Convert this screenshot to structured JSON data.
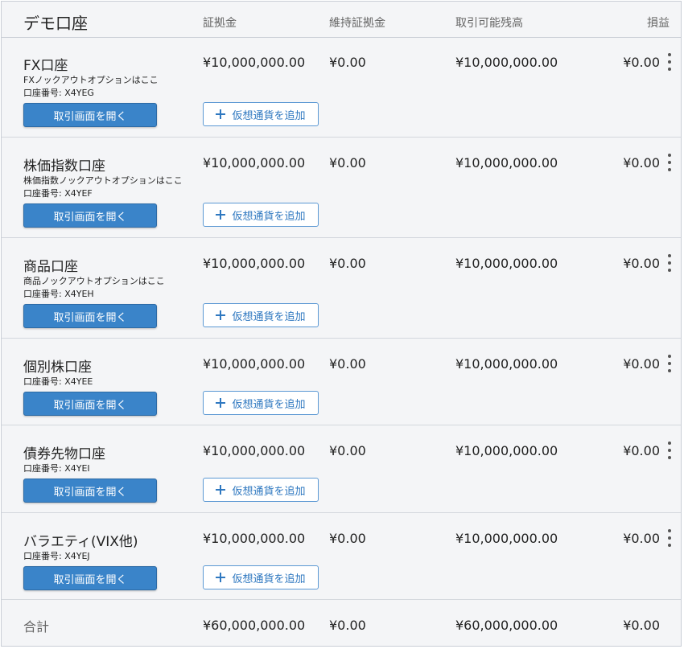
{
  "header": {
    "title": "デモ口座",
    "columns": {
      "margin": "証拠金",
      "maintenance": "維持証拠金",
      "available": "取引可能残高",
      "pl": "損益"
    }
  },
  "accounts": [
    {
      "name": "FX口座",
      "description": "FXノックアウトオプションはここ",
      "number": "口座番号: X4YEG",
      "margin": "¥10,000,000.00",
      "maintenance": "¥0.00",
      "available": "¥10,000,000.00",
      "pl": "¥0.00",
      "open_label": "取引画面を開く",
      "add_label": "仮想通貨を追加"
    },
    {
      "name": "株価指数口座",
      "description": "株価指数ノックアウトオプションはここ",
      "number": "口座番号: X4YEF",
      "margin": "¥10,000,000.00",
      "maintenance": "¥0.00",
      "available": "¥10,000,000.00",
      "pl": "¥0.00",
      "open_label": "取引画面を開く",
      "add_label": "仮想通貨を追加"
    },
    {
      "name": "商品口座",
      "description": "商品ノックアウトオプションはここ",
      "number": "口座番号: X4YEH",
      "margin": "¥10,000,000.00",
      "maintenance": "¥0.00",
      "available": "¥10,000,000.00",
      "pl": "¥0.00",
      "open_label": "取引画面を開く",
      "add_label": "仮想通貨を追加"
    },
    {
      "name": "個別株口座",
      "number": "口座番号: X4YEE",
      "margin": "¥10,000,000.00",
      "maintenance": "¥0.00",
      "available": "¥10,000,000.00",
      "pl": "¥0.00",
      "open_label": "取引画面を開く",
      "add_label": "仮想通貨を追加"
    },
    {
      "name": "債券先物口座",
      "number": "口座番号: X4YEI",
      "margin": "¥10,000,000.00",
      "maintenance": "¥0.00",
      "available": "¥10,000,000.00",
      "pl": "¥0.00",
      "open_label": "取引画面を開く",
      "add_label": "仮想通貨を追加"
    },
    {
      "name": "バラエティ(VIX他)",
      "number": "口座番号: X4YEJ",
      "margin": "¥10,000,000.00",
      "maintenance": "¥0.00",
      "available": "¥10,000,000.00",
      "pl": "¥0.00",
      "open_label": "取引画面を開く",
      "add_label": "仮想通貨を追加"
    }
  ],
  "total": {
    "label": "合計",
    "margin": "¥60,000,000.00",
    "maintenance": "¥0.00",
    "available": "¥60,000,000.00",
    "pl": "¥0.00"
  },
  "colors": {
    "primary_button": "#3a84c9",
    "outline_button": "#2f78c0",
    "background": "#f4f5f7"
  }
}
